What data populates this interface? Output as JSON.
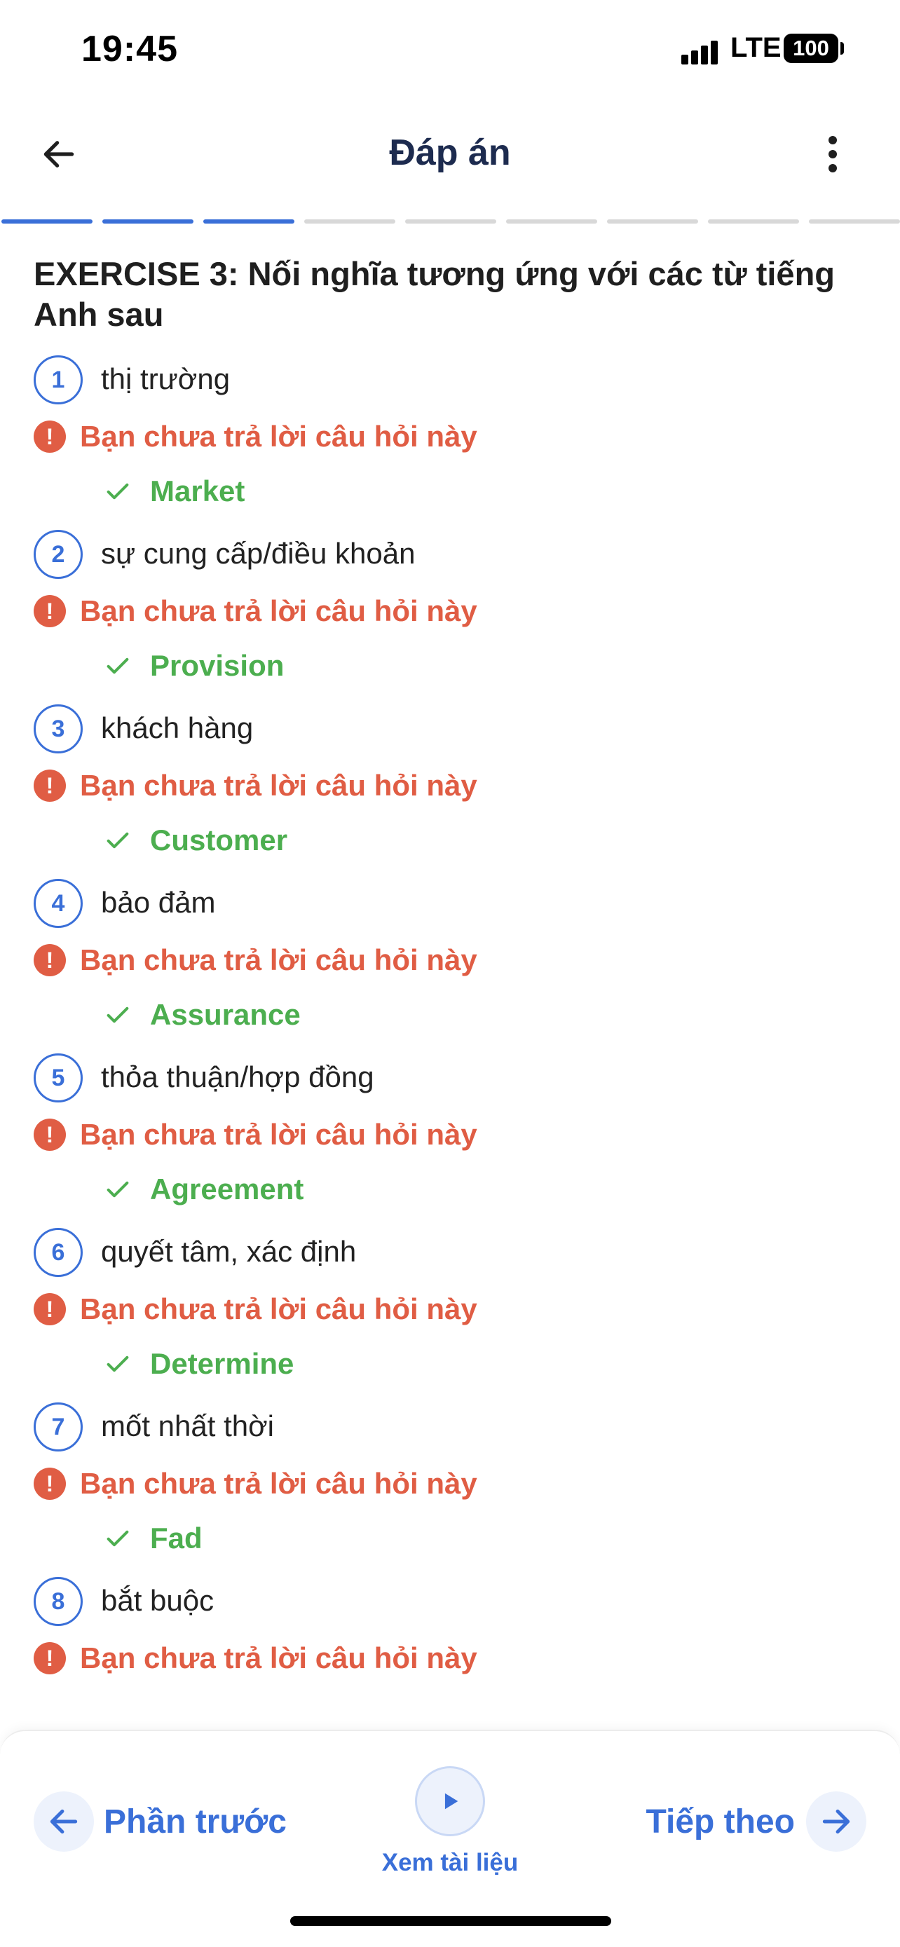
{
  "status_bar": {
    "time": "19:45",
    "network": "LTE",
    "battery": "100"
  },
  "header": {
    "title": "Đáp án",
    "back_icon": "arrow-left-icon",
    "more_icon": "more-vertical-icon"
  },
  "progress": {
    "total_segments": 9,
    "completed_segments": 3
  },
  "exercise": {
    "title": "EXERCISE 3: Nối nghĩa tương ứng với các từ tiếng Anh sau",
    "warning_text": "Bạn chưa trả lời câu hỏi này",
    "questions": [
      {
        "number": "1",
        "text": "thị trường",
        "answer": "Market"
      },
      {
        "number": "2",
        "text": "sự cung cấp/điều khoản",
        "answer": "Provision"
      },
      {
        "number": "3",
        "text": "khách hàng",
        "answer": "Customer"
      },
      {
        "number": "4",
        "text": "bảo đảm",
        "answer": "Assurance"
      },
      {
        "number": "5",
        "text": "thỏa thuận/hợp đồng",
        "answer": "Agreement"
      },
      {
        "number": "6",
        "text": "quyết tâm, xác định",
        "answer": "Determine"
      },
      {
        "number": "7",
        "text": "mốt nhất thời",
        "answer": "Fad"
      },
      {
        "number": "8",
        "text": "bắt buộc",
        "answer": ""
      }
    ]
  },
  "bottom_bar": {
    "prev_label": "Phần trước",
    "doc_label": "Xem tài liệu",
    "next_label": "Tiếp theo"
  },
  "colors": {
    "primary": "#3a6fd8",
    "warning": "#e05d44",
    "correct": "#4cae4f",
    "title": "#1d2b4f"
  }
}
